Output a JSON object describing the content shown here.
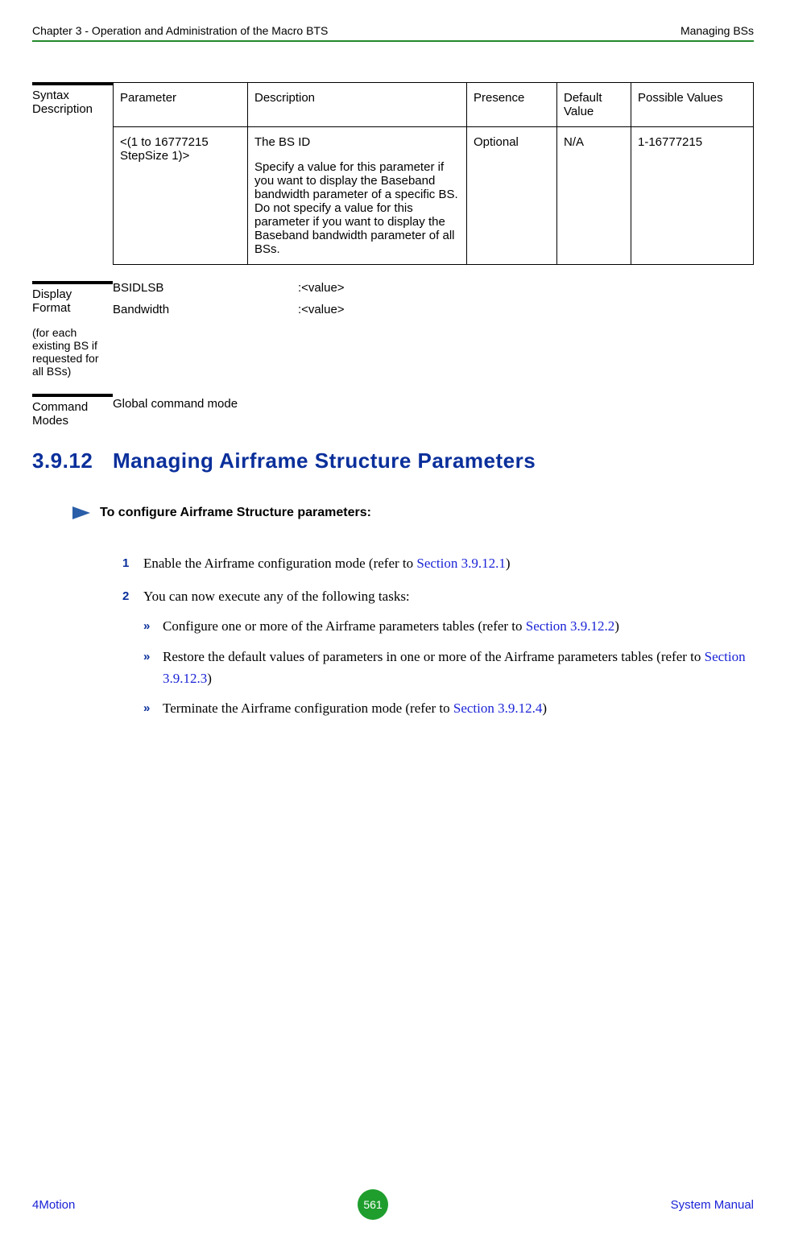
{
  "header": {
    "left": "Chapter 3 - Operation and Administration of the Macro BTS",
    "right": "Managing BSs"
  },
  "syntax": {
    "label": "Syntax Description",
    "headers": {
      "parameter": "Parameter",
      "description": "Description",
      "presence": "Presence",
      "default": "Default Value",
      "possible": "Possible Values"
    },
    "row": {
      "parameter": "<(1 to 16777215 StepSize 1)>",
      "desc_main": "The BS ID",
      "desc_body": "Specify a value for this parameter if you want to display the Baseband bandwidth parameter of a specific BS. Do not specify a value for this parameter if you want to display the Baseband bandwidth parameter of all BSs.",
      "presence": "Optional",
      "default": "N/A",
      "possible": "1-16777215"
    }
  },
  "display": {
    "label": "Display Format",
    "label_sub": "(for each existing BS if requested for all BSs)",
    "rows": [
      {
        "k": "BSIDLSB",
        "v": ":<value>"
      },
      {
        "k": "Bandwidth",
        "v": ":<value>"
      }
    ]
  },
  "command": {
    "label": "Command Modes",
    "value": "Global command mode"
  },
  "heading": {
    "num": "3.9.12",
    "title": "Managing Airframe Structure Parameters"
  },
  "procedure": {
    "title": "To configure Airframe Structure parameters:"
  },
  "steps": {
    "s1": {
      "num": "1",
      "a": "Enable the Airframe configuration mode (refer to ",
      "link": "Section 3.9.12.1",
      "b": ")"
    },
    "s2": {
      "num": "2",
      "text": "You can now execute any of the following tasks:",
      "sub1": {
        "a": "Configure one or more of the Airframe parameters tables (refer to ",
        "link": "Section 3.9.12.2",
        "b": ")"
      },
      "sub2": {
        "a": "Restore the default values of parameters in one or more of the Airframe parameters tables (refer to ",
        "link": "Section 3.9.12.3",
        "b": ")"
      },
      "sub3": {
        "a": " Terminate the Airframe configuration mode (refer to ",
        "link": "Section 3.9.12.4",
        "b": ")"
      }
    }
  },
  "footer": {
    "left": "4Motion",
    "page": "561",
    "right": "System Manual"
  },
  "bullets": {
    "arrow": "»"
  }
}
